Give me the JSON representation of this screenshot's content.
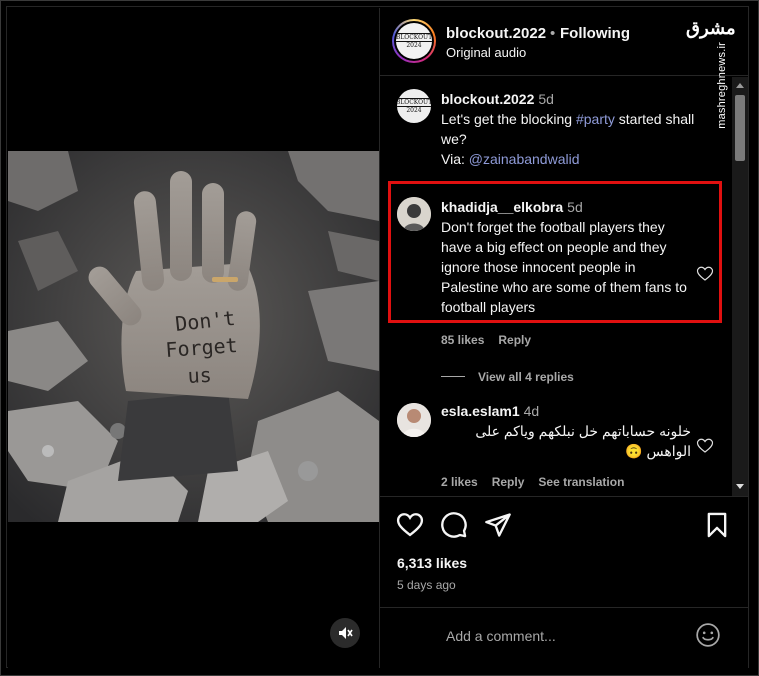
{
  "header": {
    "username": "blockout.2022",
    "separator": "•",
    "follow_state": "Following",
    "audio": "Original audio",
    "avatar_logo_lines": [
      "BLOCKOUT",
      "2024"
    ]
  },
  "watermark": {
    "logo": "مشرق",
    "site": "mashreghnews.ir"
  },
  "caption": {
    "username": "blockout.2022",
    "time": "5d",
    "text_before": "Let's get the blocking ",
    "hashtag": "#party",
    "text_after": " started shall we?",
    "via_label": "Via: ",
    "via_user": "@zainabandwalid"
  },
  "comments": [
    {
      "username": "khadidja__elkobra",
      "time": "5d",
      "text": "Don't forget the football players they have a big effect on people and they ignore those innocent people in Palestine who are some of them fans to football players",
      "likes": "85 likes",
      "reply": "Reply",
      "view_replies": "View all 4 replies"
    },
    {
      "username": "esla.eslam1",
      "time": "4d",
      "text": "خلونه حساباتهم خل نبلكهم وياكم على الواهس 🙃",
      "likes": "2 likes",
      "reply": "Reply",
      "translate": "See translation"
    }
  ],
  "post": {
    "likes": "6,313 likes",
    "time_ago": "5 days ago",
    "hand_text": [
      "Don't",
      "Forget",
      "us"
    ]
  },
  "composer": {
    "placeholder": "Add a comment..."
  },
  "icons": {
    "like": "heart-icon",
    "comment": "comment-icon",
    "share": "share-icon",
    "save": "bookmark-icon",
    "emoji": "emoji-icon",
    "mute": "muted-speaker-icon"
  },
  "colors": {
    "highlight_box": "#e01010",
    "hashtag": "#8f9bd8"
  }
}
